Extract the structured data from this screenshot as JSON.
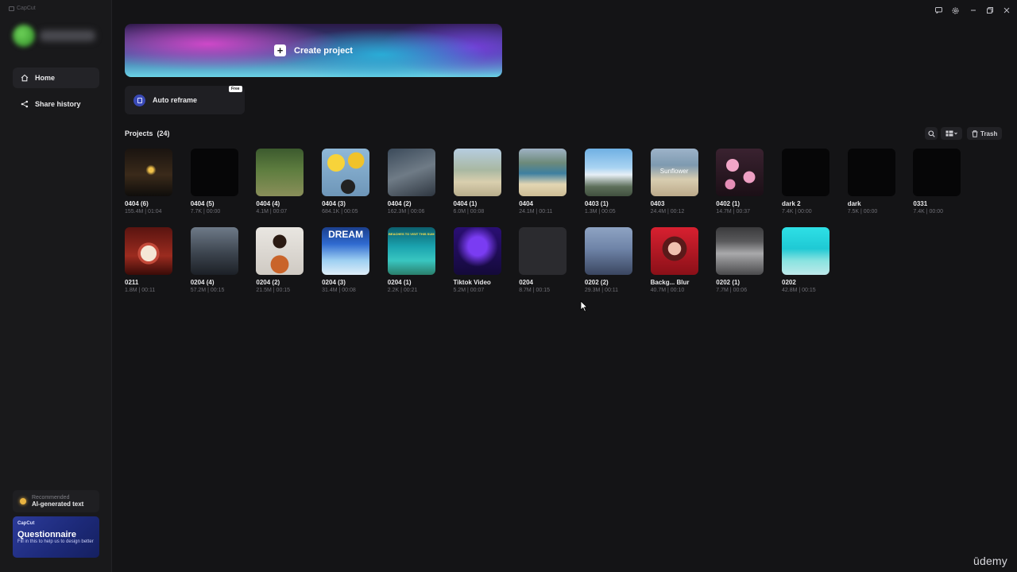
{
  "app": {
    "title": "CapCut"
  },
  "profile": {
    "name": ""
  },
  "nav": {
    "home": "Home",
    "share_history": "Share history"
  },
  "promo": {
    "recommended_label": "Recommended",
    "recommended_title": "AI-generated text",
    "card_brand": "CapCut",
    "card_title": "Questionnaire",
    "card_desc": "Fill in this to help us to design better"
  },
  "create": {
    "label": "Create project"
  },
  "auto_reframe": {
    "label": "Auto reframe",
    "badge": "Free"
  },
  "projects": {
    "title": "Projects",
    "count": "(24)",
    "trash_label": "Trash",
    "items": [
      {
        "name": "0404 (6)",
        "meta": "155.4M | 01:04",
        "thumb": "city-night"
      },
      {
        "name": "0404 (5)",
        "meta": "7.7K | 00:00",
        "thumb": "black"
      },
      {
        "name": "0404 (4)",
        "meta": "4.1M | 00:07",
        "thumb": "forest-walk"
      },
      {
        "name": "0404 (3)",
        "meta": "684.1K | 00:05",
        "thumb": "yellow-balloons"
      },
      {
        "name": "0404 (2)",
        "meta": "162.3M | 00:06",
        "thumb": "road"
      },
      {
        "name": "0404 (1)",
        "meta": "6.0M | 00:08",
        "thumb": "beach-dance"
      },
      {
        "name": "0404",
        "meta": "24.1M | 00:11",
        "thumb": "beach-aerial"
      },
      {
        "name": "0403 (1)",
        "meta": "1.3M | 00:05",
        "thumb": "sky-bridge"
      },
      {
        "name": "0403",
        "meta": "24.4M | 00:12",
        "thumb": "beach-sunflower",
        "overlay_text": "Sunflower"
      },
      {
        "name": "0402 (1)",
        "meta": "14.7M | 00:37",
        "thumb": "pink-flowers"
      },
      {
        "name": "dark 2",
        "meta": "7.4K | 00:00",
        "thumb": "black"
      },
      {
        "name": "dark",
        "meta": "7.5K | 00:00",
        "thumb": "black"
      },
      {
        "name": "0331",
        "meta": "7.4K | 00:00",
        "thumb": "black"
      },
      {
        "name": "0211",
        "meta": "1.8M | 00:11",
        "thumb": "snow-globe"
      },
      {
        "name": "0204 (4)",
        "meta": "57.2M | 00:15",
        "thumb": "gym"
      },
      {
        "name": "0204 (2)",
        "meta": "21.5M | 00:15",
        "thumb": "basketball"
      },
      {
        "name": "0204 (3)",
        "meta": "31.4M | 00:08",
        "thumb": "dream",
        "overlay_text": "DREAM"
      },
      {
        "name": "0204 (1)",
        "meta": "2.2K | 00:21",
        "thumb": "beach-ad",
        "overlay_text": "BEACHES TO VISIT THIS SUM"
      },
      {
        "name": "Tiktok Video",
        "meta": "5.2M | 00:07",
        "thumb": "neon-purple"
      },
      {
        "name": "0204",
        "meta": "8.7M | 00:15",
        "thumb": "gray"
      },
      {
        "name": "0202 (2)",
        "meta": "29.3M | 00:11",
        "thumb": "motorbike"
      },
      {
        "name": "Backg... Blur",
        "meta": "40.7M | 00:10",
        "thumb": "portrait-red"
      },
      {
        "name": "0202 (1)",
        "meta": "7.7M | 00:06",
        "thumb": "paper"
      },
      {
        "name": "0202",
        "meta": "42.8M | 00:15",
        "thumb": "cyan-sea"
      }
    ]
  },
  "watermark": "ūdemy"
}
